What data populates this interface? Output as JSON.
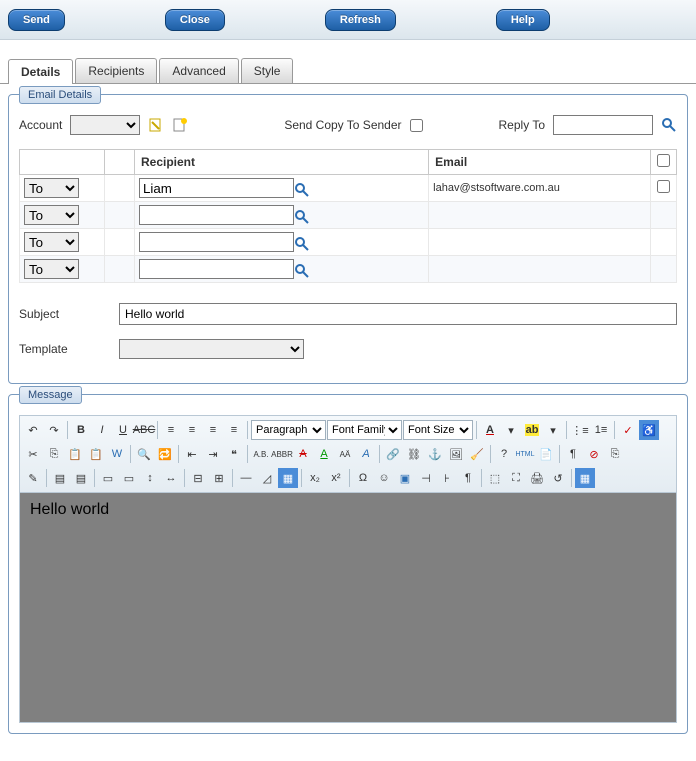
{
  "toolbar": {
    "send": "Send",
    "close": "Close",
    "refresh": "Refresh",
    "help": "Help"
  },
  "tabs": {
    "details": "Details",
    "recipients": "Recipients",
    "advanced": "Advanced",
    "style": "Style"
  },
  "groups": {
    "emailDetails": "Email Details",
    "message": "Message"
  },
  "labels": {
    "account": "Account",
    "sendCopy": "Send Copy To Sender",
    "replyTo": "Reply To",
    "subject": "Subject",
    "template": "Template"
  },
  "recipTable": {
    "headers": {
      "recipient": "Recipient",
      "email": "Email"
    },
    "rows": [
      {
        "type": "To",
        "recipient": "Liam",
        "email": "lahav@stsoftware.com.au"
      },
      {
        "type": "To",
        "recipient": "",
        "email": ""
      },
      {
        "type": "To",
        "recipient": "",
        "email": ""
      },
      {
        "type": "To",
        "recipient": "",
        "email": ""
      }
    ]
  },
  "fields": {
    "accountValue": "",
    "replyToValue": "",
    "subjectValue": "Hello world",
    "templateValue": ""
  },
  "editor": {
    "paragraph": "Paragraph",
    "fontFamily": "Font Family",
    "fontSize": "Font Size",
    "html": "HTML",
    "content": "Hello world"
  }
}
